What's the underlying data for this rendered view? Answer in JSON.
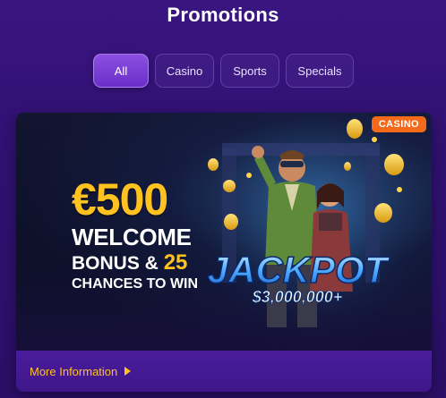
{
  "page": {
    "title": "Promotions"
  },
  "tabs": [
    {
      "label": "All",
      "active": true
    },
    {
      "label": "Casino",
      "active": false
    },
    {
      "label": "Sports",
      "active": false
    },
    {
      "label": "Specials",
      "active": false
    }
  ],
  "promo_card": {
    "badge": "CASINO",
    "amount": "€500",
    "line1": "WELCOME",
    "line2_prefix": "BONUS &",
    "line2_highlight": "25",
    "line3": "CHANCES TO WIN",
    "jackpot_title": "JACKPOT",
    "jackpot_amount": "$3,000,000+",
    "more_info": "More Information",
    "more_info_icon": "triangle-right-icon"
  },
  "colors": {
    "background": "#2f1170",
    "accent_gold": "#ffc21f",
    "badge_orange": "#f26a1a",
    "tab_active": "#7a3fd6"
  }
}
